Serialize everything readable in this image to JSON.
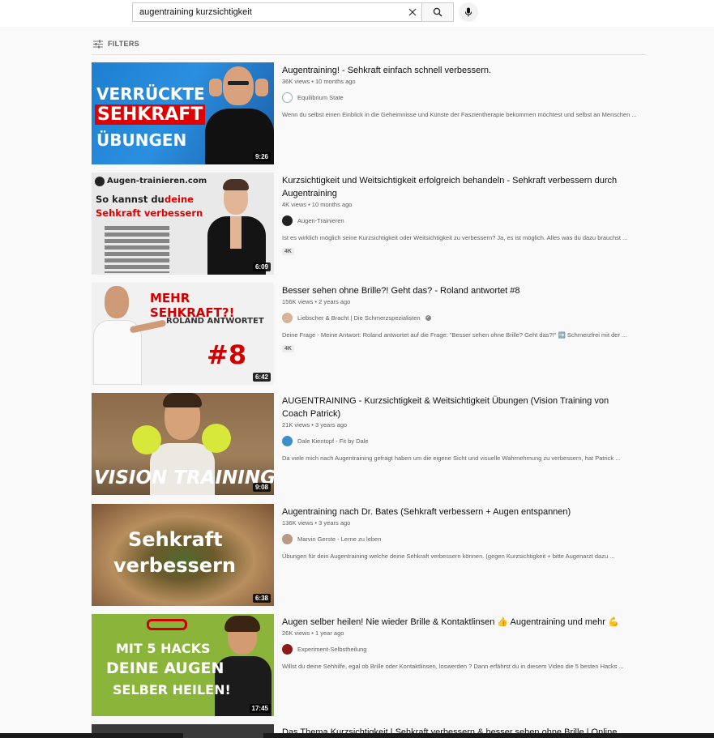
{
  "search": {
    "query": "augentraining kurzsichtigkeit"
  },
  "filters": {
    "label": "FILTERS"
  },
  "results": [
    {
      "title": "Augentraining! - Sehkraft einfach schnell verbessern.",
      "meta": "36K views • 10 months ago",
      "channel": "Equilibrium State",
      "description": "Wenn du selbst einen Einblick in die Geheimnisse und Künste der Faszientherapie bekommen möchtest und selbst an Menschen ...",
      "duration": "9:26",
      "thumb_text": [
        "VERRÜCKTE",
        "SEHKRAFT",
        "ÜBUNGEN"
      ]
    },
    {
      "title": "Kurzsichtigkeit und Weitsichtigkeit erfolgreich behandeln - Sehkraft verbessern durch Augentraining",
      "meta": "4K views • 10 months ago",
      "channel": "Augen-Trainieren",
      "description": "Ist es wirklich möglich seine Kurzsichtigkeit oder Weitsichtigkeit zu verbessern? Ja, es ist möglich. Alles was du dazu brauchst ...",
      "badge": "4K",
      "duration": "6:09",
      "thumb_text": [
        "Augen-trainieren.com",
        "So kannst du",
        "deine",
        "Sehkraft verbessern"
      ]
    },
    {
      "title": "Besser sehen ohne Brille?! Geht das? - Roland antwortet #8",
      "meta": "156K views • 2 years ago",
      "channel": "Liebscher & Bracht | Die Schmerzspezialisten",
      "description": "Deine Frage - Meine Antwort: Roland antwortet auf die Frage: \"Besser sehen ohne Brille? Geht das?!\" ➡️ Schmerzfrei mit der ...",
      "badge": "4K",
      "duration": "6:42",
      "thumb_text": [
        "MEHR SEHKRAFT?!",
        "ROLAND ANTWORTET",
        "#8"
      ]
    },
    {
      "title": "AUGENTRAINING - Kurzsichtigkeit & Weitsichtigkeit Übungen (Vision Training von Coach Patrick)",
      "meta": "21K views • 3 years ago",
      "channel": "Dale Kientopf - Fit by Dale",
      "description": "Da viele mich nach Augentraining gefragt haben um die eigene Sicht und visuelle Wahrnehmung zu verbessern, hat Patrick ...",
      "duration": "9:08",
      "thumb_text": [
        "VISION TRAINING"
      ]
    },
    {
      "title": "Augentraining nach Dr. Bates (Sehkraft verbessern + Augen entspannen)",
      "meta": "136K views • 3 years ago",
      "channel": "Marvin Gerste - Lerne zu leben",
      "description": "Übungen für dein Augentraining welche deine Sehkraft verbessern können. (gegen Kurzsichtigkeit + bitte Augenarzt dazu ...",
      "duration": "6:38",
      "thumb_text": [
        "Sehkraft",
        "verbessern"
      ]
    },
    {
      "title": "Augen selber heilen! Nie wieder Brille & Kontaktlinsen 👍 Augentraining und mehr 💪",
      "meta": "26K views • 1 year ago",
      "channel": "Experiment-Selbstheilung",
      "description": "Willst du deine Sehhilfe, egal ob Brille oder Kontaktlinsen, loswerden ? Dann erfährst du in diesem Video die 5 besten Hacks ...",
      "duration": "17:45",
      "thumb_text": [
        "MIT 5 HACKS",
        "DEINE AUGEN",
        "SELBER HEILEN!"
      ]
    },
    {
      "title": "Das Thema Kurzsichtigkeit | Sehkraft verbessern & besser sehen ohne Brille | Online"
    }
  ],
  "colors": {
    "page_bg": "#f9f9f9",
    "text_primary": "#0f0f0f",
    "text_secondary": "#606060",
    "accent_red": "#e00000"
  }
}
